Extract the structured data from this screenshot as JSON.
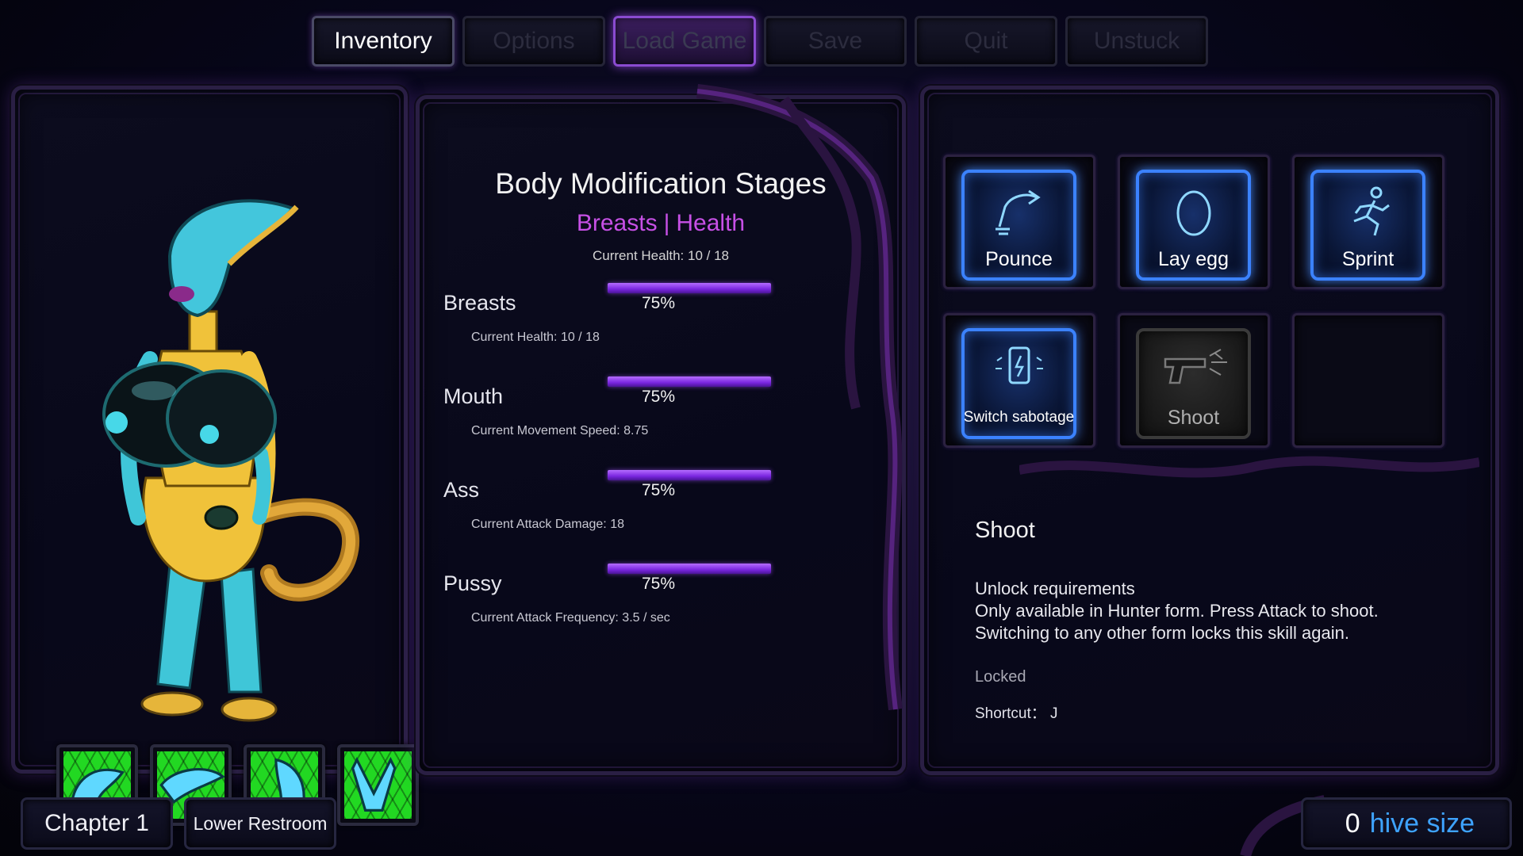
{
  "nav": {
    "inventory": "Inventory",
    "options": "Options",
    "load_game": "Load Game",
    "save": "Save",
    "quit": "Quit",
    "unstuck": "Unstuck"
  },
  "body_mods": {
    "title": "Body Modification Stages",
    "sub_left": "Breasts",
    "sub_right": "Health",
    "separator": "|",
    "current": "Current Health: 10 / 18",
    "stats": [
      {
        "name": "Breasts",
        "percent": "75%",
        "desc": "Current Health: 10 / 18"
      },
      {
        "name": "Mouth",
        "percent": "75%",
        "desc": "Current Movement Speed: 8.75"
      },
      {
        "name": "Ass",
        "percent": "75%",
        "desc": "Current Attack Damage: 18"
      },
      {
        "name": "Pussy",
        "percent": "75%",
        "desc": "Current Attack Frequency: 3.5 / sec"
      }
    ]
  },
  "skills": [
    {
      "label": "Pounce",
      "icon": "pounce-icon",
      "state": "unlocked"
    },
    {
      "label": "Lay egg",
      "icon": "egg-icon",
      "state": "unlocked"
    },
    {
      "label": "Sprint",
      "icon": "sprint-icon",
      "state": "unlocked"
    },
    {
      "label": "Switch sabotage",
      "icon": "phone-sabotage-icon",
      "state": "unlocked"
    },
    {
      "label": "Shoot",
      "icon": "gun-icon",
      "state": "locked"
    },
    {
      "label": "",
      "icon": "",
      "state": "empty"
    }
  ],
  "detail": {
    "title": "Shoot",
    "requirement_heading": "Unlock requirements",
    "requirement_line1": "Only available in Hunter form. Press Attack to shoot.",
    "requirement_line2": "Switching to any other form locks this skill again.",
    "status": "Locked",
    "shortcut": "Shortcut： J"
  },
  "footer": {
    "chapter": "Chapter 1",
    "location": "Lower Restroom",
    "hive_count": "0",
    "hive_label": "hive size"
  },
  "colors": {
    "accent_purple": "#c750e6",
    "bar_purple": "#8a30f0",
    "skill_blue": "#3b82ff",
    "hive_blue": "#3ea3ff"
  }
}
